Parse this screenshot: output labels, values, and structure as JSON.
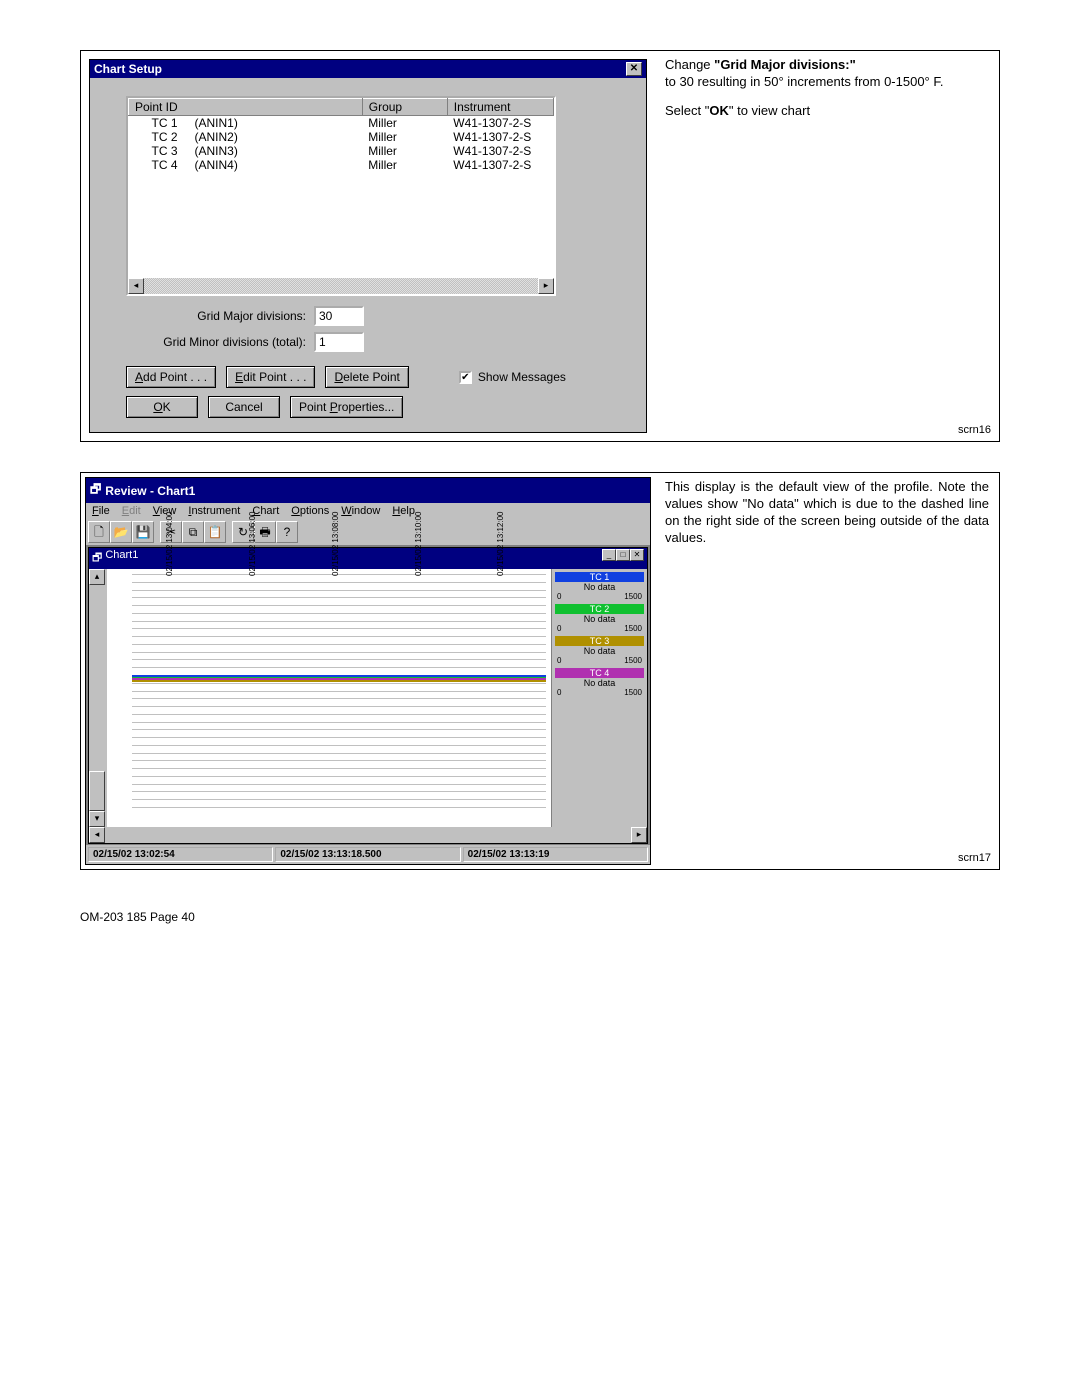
{
  "chart_setup": {
    "title": "Chart Setup",
    "columns": {
      "c1": "Point ID",
      "c2": "Group",
      "c3": "Instrument"
    },
    "rows": [
      {
        "id": "TC 1",
        "an": "(ANIN1)",
        "group": "Miller",
        "inst": "W41-1307-2-S"
      },
      {
        "id": "TC 2",
        "an": "(ANIN2)",
        "group": "Miller",
        "inst": "W41-1307-2-S"
      },
      {
        "id": "TC 3",
        "an": "(ANIN3)",
        "group": "Miller",
        "inst": "W41-1307-2-S"
      },
      {
        "id": "TC 4",
        "an": "(ANIN4)",
        "group": "Miller",
        "inst": "W41-1307-2-S"
      }
    ],
    "labels": {
      "grid_major": "Grid Major divisions:",
      "grid_minor": "Grid Minor divisions (total):",
      "show_messages": "Show Messages",
      "add": "Add Point . . .",
      "edit": "Edit Point . . .",
      "delete": "Delete Point",
      "ok": "OK",
      "cancel": "Cancel",
      "props": "Point Properties..."
    },
    "values": {
      "grid_major": "30",
      "grid_minor": "1"
    }
  },
  "side1": {
    "l1a": "Change ",
    "l1b": "\"Grid Major divisions:\"",
    "l2": "to 30 resulting in 50° increments from 0-1500° F.",
    "l3a": "Select \"",
    "l3b": "OK",
    "l3c": "\" to view chart",
    "id": "scrn16"
  },
  "review": {
    "title": "Review - Chart1",
    "menu": [
      "File",
      "Edit",
      "View",
      "Instrument",
      "Chart",
      "Options",
      "Window",
      "Help"
    ],
    "mdi_title": "Chart1",
    "xticks": [
      "02/15/02\n13:04:00",
      "02/15/02\n13:06:00",
      "02/15/02\n13:08:00",
      "02/15/02\n13:10:00",
      "02/15/02\n13:12:00"
    ],
    "legend": [
      {
        "name": "TC 1",
        "color": "#1040e0",
        "nd": "No data",
        "lo": "0",
        "hi": "1500"
      },
      {
        "name": "TC 2",
        "color": "#10c030",
        "nd": "No data",
        "lo": "0",
        "hi": "1500"
      },
      {
        "name": "TC 3",
        "color": "#b09000",
        "nd": "No data",
        "lo": "0",
        "hi": "1500"
      },
      {
        "name": "TC 4",
        "color": "#b030b0",
        "nd": "No data",
        "lo": "0",
        "hi": "1500"
      }
    ],
    "status": [
      "02/15/02 13:02:54",
      "02/15/02 13:13:18.500",
      "02/15/02 13:13:19"
    ]
  },
  "side2": {
    "p": "This display is the default view of the profile. Note the values show \"No data\" which is due to the dashed line on the right side of the screen being outside of the data values.",
    "id": "scrn17"
  },
  "chart_data": {
    "type": "line",
    "title": "Chart1",
    "xlabel": "",
    "ylabel": "",
    "x": [
      "13:04:00",
      "13:06:00",
      "13:08:00",
      "13:10:00",
      "13:12:00"
    ],
    "ylim": [
      0,
      1500
    ],
    "series": [
      {
        "name": "TC 1",
        "values": [
          850,
          850,
          850,
          850,
          850
        ]
      },
      {
        "name": "TC 2",
        "values": [
          840,
          840,
          840,
          840,
          840
        ]
      },
      {
        "name": "TC 3",
        "values": [
          820,
          820,
          820,
          820,
          820
        ]
      },
      {
        "name": "TC 4",
        "values": [
          830,
          830,
          830,
          830,
          830
        ]
      }
    ]
  },
  "footer": "OM-203 185 Page 40"
}
